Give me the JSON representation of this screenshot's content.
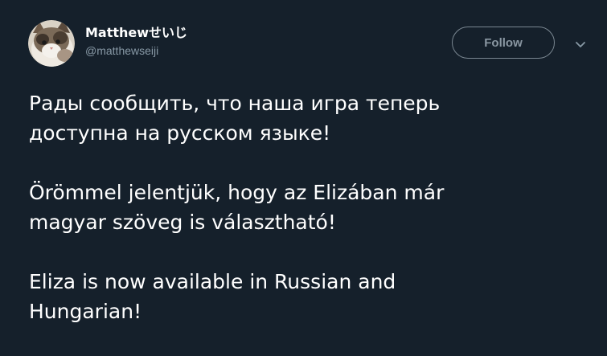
{
  "tweet": {
    "author": {
      "display_name": "Matthewせいじ",
      "handle": "@matthewseiji"
    },
    "follow_label": "Follow",
    "paragraphs": [
      {
        "line1": "Рады сообщить, что наша игра теперь",
        "line2": "доступна на русском языке!"
      },
      {
        "line1": "Örömmel jelentjük, hogy az Elizában már",
        "line2": "magyar szöveg is választható!"
      },
      {
        "line1": "Eliza is now available in Russian and",
        "line2": "Hungarian!"
      }
    ]
  },
  "icons": {
    "caret": "chevron-down-icon",
    "avatar": "cat-avatar"
  },
  "colors": {
    "background": "#15202b",
    "text": "#ffffff",
    "secondary_text": "#8899a6",
    "button_border": "#7a8791"
  }
}
